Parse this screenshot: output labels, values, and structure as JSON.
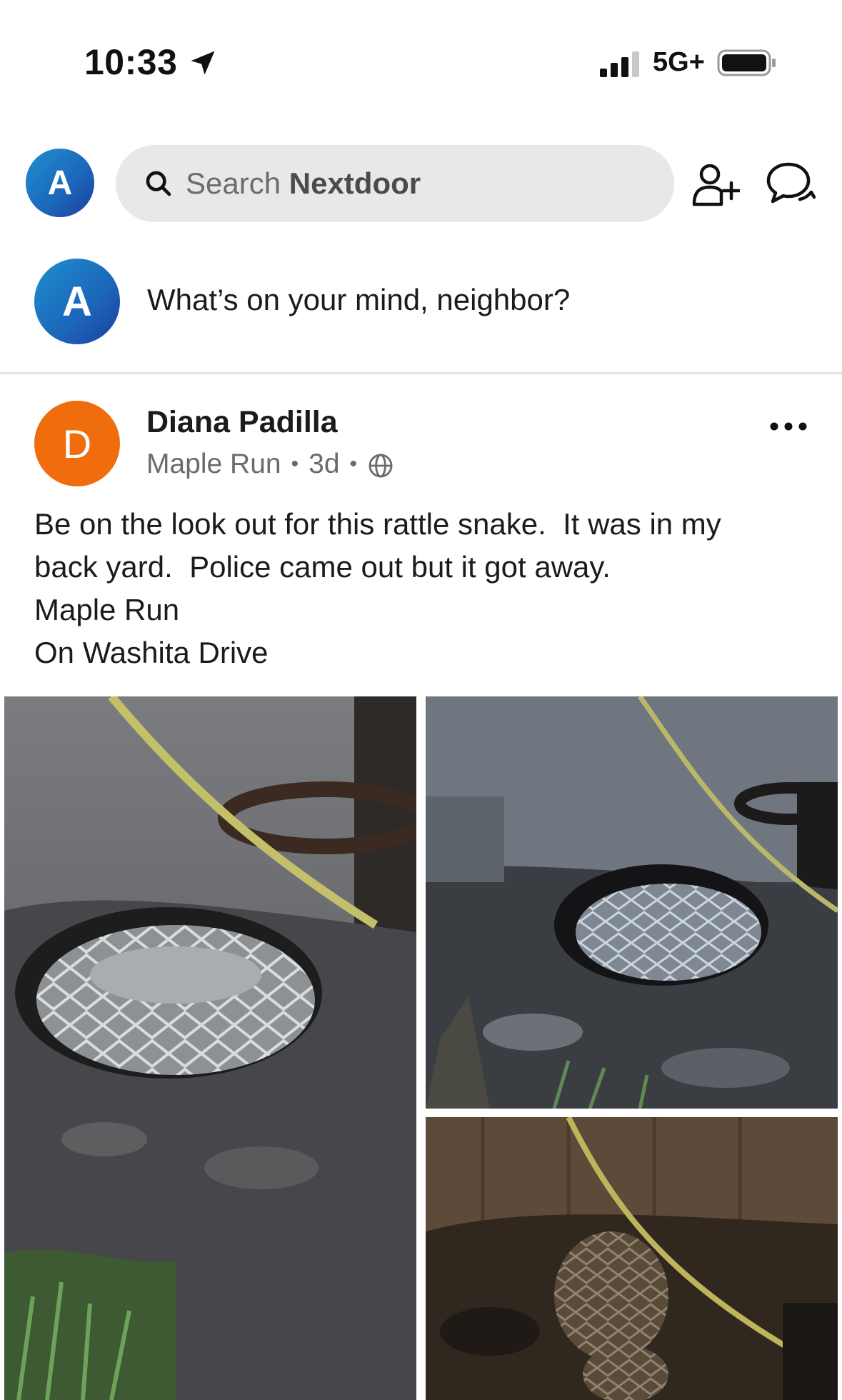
{
  "status_bar": {
    "time": "10:33",
    "network": "5G+",
    "icons": [
      "location-arrow-icon",
      "signal-icon",
      "battery-icon"
    ]
  },
  "top_nav": {
    "avatar_letter": "A",
    "search": {
      "prefix": "Search ",
      "brand": "Nextdoor"
    },
    "icons": [
      "search-icon",
      "add-neighbor-icon",
      "chat-icon"
    ]
  },
  "composer": {
    "avatar_letter": "A",
    "prompt": "What’s on your mind, neighbor?"
  },
  "post": {
    "avatar_letter": "D",
    "author": "Diana Padilla",
    "neighborhood": "Maple Run",
    "age": "3d",
    "separator": "•",
    "icons": [
      "globe-icon",
      "more-options-icon"
    ],
    "body_lines": [
      "Be on the look out for this rattle snake.  It was in my",
      "back yard.  Police came out but it got away.",
      "Maple Run",
      "On Washita Drive"
    ],
    "photos": [
      "photo-snake-closeup",
      "photo-snake-by-fence",
      "photo-snake-dirt"
    ]
  },
  "colors": {
    "avatar_blue": "#1c66b9",
    "avatar_orange": "#ef6d0c",
    "search_bg": "#e8e8e8",
    "muted_text": "#6b6b6b"
  }
}
